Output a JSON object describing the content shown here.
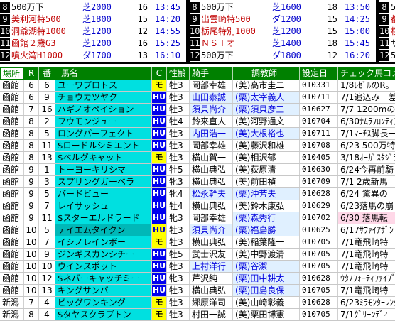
{
  "panels": [
    {
      "rows": [
        {
          "num": "8",
          "name": "500万下",
          "cond": "芝2000",
          "n": "16",
          "time": "13:45"
        },
        {
          "num": "9",
          "name": "美利河特500",
          "cond": "芝1800",
          "n": "15",
          "time": "14:20"
        },
        {
          "num": "10",
          "name": "洞爺湖特1000",
          "cond": "芝1200",
          "n": "12",
          "time": "14:55"
        },
        {
          "num": "11",
          "name": "函館２歳G3",
          "cond": "芝1200",
          "n": "16",
          "time": "15:25"
        },
        {
          "num": "12",
          "name": "噴火湾H1000",
          "cond": "ダ1700",
          "n": "13",
          "time": "16:10"
        }
      ]
    },
    {
      "rows": [
        {
          "num": "8",
          "name": "500万下",
          "cond": "芝1600",
          "n": "18",
          "time": "13:50"
        },
        {
          "num": "9",
          "name": "出雲崎特500",
          "cond": "ダ1200",
          "n": "15",
          "time": "14:25"
        },
        {
          "num": "10",
          "name": "栃尾特別1000",
          "cond": "芝1200",
          "n": "15",
          "time": "15:00"
        },
        {
          "num": "11",
          "name": "ＮＳＴオ",
          "cond": "芝1400",
          "n": "18",
          "time": "15:45"
        },
        {
          "num": "12",
          "name": "500万下",
          "cond": "ダ1800",
          "n": "12",
          "time": "16:20"
        }
      ]
    },
    {
      "rows": [
        {
          "num": "8",
          "name": "500万",
          "cond": "",
          "n": "",
          "time": ""
        },
        {
          "num": "9",
          "name": "都井",
          "cond": "",
          "n": "",
          "time": ""
        },
        {
          "num": "10",
          "name": "桜島",
          "cond": "",
          "n": "",
          "time": ""
        },
        {
          "num": "11",
          "name": "サマ",
          "cond": "",
          "n": "",
          "time": ""
        },
        {
          "num": "12",
          "name": "500",
          "cond": "",
          "n": "",
          "time": ""
        }
      ]
    }
  ],
  "header": {
    "place": "場所",
    "race": "R",
    "ban": "番",
    "name": "馬名",
    "mark": "C",
    "sex": "性齢",
    "jockey": "騎手",
    "trainer": "調教師",
    "date": "設定日",
    "comment": "チェック馬コメ"
  },
  "rows": [
    {
      "place": "函館",
      "r": "6",
      "ban": "6",
      "name": "ユーワプロトス",
      "mark": "モ",
      "mk": "mo",
      "sex": "牡3",
      "jockey": "岡部幸雄",
      "jhl": false,
      "trainer": "(美)高市圭二",
      "thl": false,
      "date": "010331",
      "cmt": "1/8ﾚｾﾞﾙのR。",
      "pink": false
    },
    {
      "place": "函館",
      "r": "6",
      "ban": "9",
      "name": "チョウカツヤク",
      "mark": "HU",
      "mk": "hu",
      "sex": "牡3",
      "jockey": "山田泰誠",
      "jhl": true,
      "trainer": "(栗)太宰義人",
      "thl": true,
      "date": "010711",
      "cmt": "7/1追込み一差",
      "pink": false
    },
    {
      "place": "函館",
      "r": "7",
      "ban": "16",
      "name": "ハギノオペイション",
      "mark": "HU",
      "mk": "hu",
      "sex": "牡3",
      "jockey": "須貝尚介",
      "jhl": true,
      "trainer": "(栗)須貝彦三",
      "thl": true,
      "date": "010627",
      "cmt": "7/7 1200mの方",
      "pink": false
    },
    {
      "place": "函館",
      "r": "8",
      "ban": "2",
      "name": "フウモンジュー",
      "mark": "HU",
      "mk": "hu",
      "sex": "牡4",
      "jockey": "鈴来直人",
      "jhl": false,
      "trainer": "(美)河野通文",
      "thl": false,
      "date": "010704",
      "cmt": "6/30ﾅﾑﾗﾌﾛﾝﾃｨｱ",
      "pink": false
    },
    {
      "place": "函館",
      "r": "8",
      "ban": "5",
      "name": "ロングパーフェクト",
      "mark": "HU",
      "mk": "hu",
      "sex": "牡3",
      "jockey": "内田浩一",
      "jhl": true,
      "trainer": "(美)大根裕也",
      "thl": true,
      "date": "010711",
      "cmt": "7/1ﾏｰﾁｽ脚長一",
      "pink": false
    },
    {
      "place": "函館",
      "r": "8",
      "ban": "11",
      "name": "$ロードルシミエント",
      "mark": "HU",
      "mk": "hu",
      "sex": "牡3",
      "jockey": "岡部幸雄",
      "jhl": false,
      "trainer": "(美)藤沢和雄",
      "thl": false,
      "date": "010708",
      "cmt": "6/23 500万特別",
      "pink": false
    },
    {
      "place": "函館",
      "r": "8",
      "ban": "13",
      "name": "$ベルグキャット",
      "mark": "モ",
      "mk": "mo",
      "sex": "牡3",
      "jockey": "横山賀一",
      "jhl": false,
      "trainer": "(美)相沢郁",
      "thl": false,
      "date": "010405",
      "cmt": "3/18ｵｰｶﾞｽﾀｼﾞﾃｰ",
      "pink": false
    },
    {
      "place": "函館",
      "r": "9",
      "ban": "1",
      "name": "トーヨーキリシマ",
      "mark": "HU",
      "mk": "hu",
      "sex": "牡5",
      "jockey": "横山典弘",
      "jhl": false,
      "trainer": "(美)荻原清",
      "thl": false,
      "date": "010630",
      "cmt": "6/24今再前騎",
      "pink": false
    },
    {
      "place": "函館",
      "r": "9",
      "ban": "3",
      "name": "スプリングガーベラ",
      "mark": "HU",
      "mk": "hu",
      "sex": "牝3",
      "jockey": "横山典弘",
      "jhl": false,
      "trainer": "(美)前田禎",
      "thl": false,
      "date": "010709",
      "cmt": "7/1 2歳新馬",
      "pink": false
    },
    {
      "place": "函館",
      "r": "9",
      "ban": "5",
      "name": "バードビュー",
      "mark": "HU",
      "mk": "hu",
      "sex": "牝4",
      "jockey": "松永幹夫",
      "jhl": true,
      "trainer": "(栗)沖芳夫",
      "thl": true,
      "date": "010628",
      "cmt": "6/24 驚異の",
      "pink": false
    },
    {
      "place": "函館",
      "r": "9",
      "ban": "7",
      "name": "レイサッシュ",
      "mark": "HU",
      "mk": "hu",
      "sex": "牡4",
      "jockey": "横山典弘",
      "jhl": false,
      "trainer": "(美)鈴木康弘",
      "thl": false,
      "date": "010629",
      "cmt": "6/23落馬の崩",
      "pink": false
    },
    {
      "place": "函館",
      "r": "9",
      "ban": "11",
      "name": "$スターエルドラード",
      "mark": "HU",
      "mk": "hu",
      "sex": "牝3",
      "jockey": "岡部幸雄",
      "jhl": false,
      "trainer": "(栗)森秀行",
      "thl": true,
      "date": "010702",
      "cmt": "6/30 落馬転",
      "pink": true
    },
    {
      "place": "函館",
      "r": "10",
      "ban": "5",
      "name": "テイエムタイクン",
      "mark": "HU",
      "mk": "hu2",
      "sex": "牡3",
      "jockey": "須貝尚介",
      "jhl": true,
      "trainer": "(栗)福島勝",
      "thl": true,
      "date": "010625",
      "cmt": "6/17ｻﾌｧｲｱｻﾞﾝ",
      "pink": false
    },
    {
      "place": "函館",
      "r": "10",
      "ban": "7",
      "name": "イシノレインボー",
      "mark": "モ",
      "mk": "mo",
      "sex": "牡3",
      "jockey": "横山典弘",
      "jhl": false,
      "trainer": "(美)稲葉隆一",
      "thl": false,
      "date": "010705",
      "cmt": "7/1竜飛崎特",
      "pink": false
    },
    {
      "place": "函館",
      "r": "10",
      "ban": "9",
      "name": "ジンギスカンシチー",
      "mark": "HU",
      "mk": "hu",
      "sex": "牡5",
      "jockey": "武士沢友",
      "jhl": false,
      "trainer": "(美)中野渡清",
      "thl": false,
      "date": "010705",
      "cmt": "7/1竜飛崎特",
      "pink": false
    },
    {
      "place": "函館",
      "r": "10",
      "ban": "10",
      "name": "ウインスポット",
      "mark": "HU",
      "mk": "hu",
      "sex": "牡3",
      "jockey": "上村洋行",
      "jhl": true,
      "trainer": "(栗)谷潔",
      "thl": true,
      "date": "010705",
      "cmt": "7/1竜飛崎特",
      "pink": false
    },
    {
      "place": "函館",
      "r": "10",
      "ban": "12",
      "name": "$ネバーキャッチミー",
      "mark": "HU",
      "mk": "hu",
      "sex": "牝3",
      "jockey": "芹沢純一",
      "jhl": false,
      "trainer": "(栗)田中耕太",
      "thl": true,
      "date": "010628",
      "cmt": "ｳﾀﾉﾌｫｰﾃｨﾌｧｲﾌﾞ",
      "pink": false
    },
    {
      "place": "函館",
      "r": "10",
      "ban": "13",
      "name": "キングサンバ",
      "mark": "HU",
      "mk": "hu",
      "sex": "牡3",
      "jockey": "横山典弘",
      "jhl": false,
      "trainer": "(栗)田島良保",
      "thl": true,
      "date": "010705",
      "cmt": "7/1竜飛崎特",
      "pink": false
    },
    {
      "place": "新潟",
      "r": "7",
      "ban": "4",
      "name": "ビッグワンキング",
      "mark": "モ",
      "mk": "mo",
      "sex": "牡3",
      "jockey": "郷原洋司",
      "jhl": false,
      "trainer": "(美)山崎彰義",
      "thl": false,
      "date": "010628",
      "cmt": "6/23ﾐﾗﾓﾝﾀｰﾚﾝｸﾞ",
      "pink": false
    },
    {
      "place": "新潟",
      "r": "8",
      "ban": "4",
      "name": "$タヤスクラブトン",
      "mark": "モ",
      "mk": "mo",
      "sex": "牡3",
      "jockey": "村田一誠",
      "jhl": false,
      "trainer": "(美)栗田博憲",
      "thl": false,
      "date": "010705",
      "cmt": "7/1ｸﾞﾘｰﾝﾃﾞｨ",
      "pink": false
    }
  ]
}
